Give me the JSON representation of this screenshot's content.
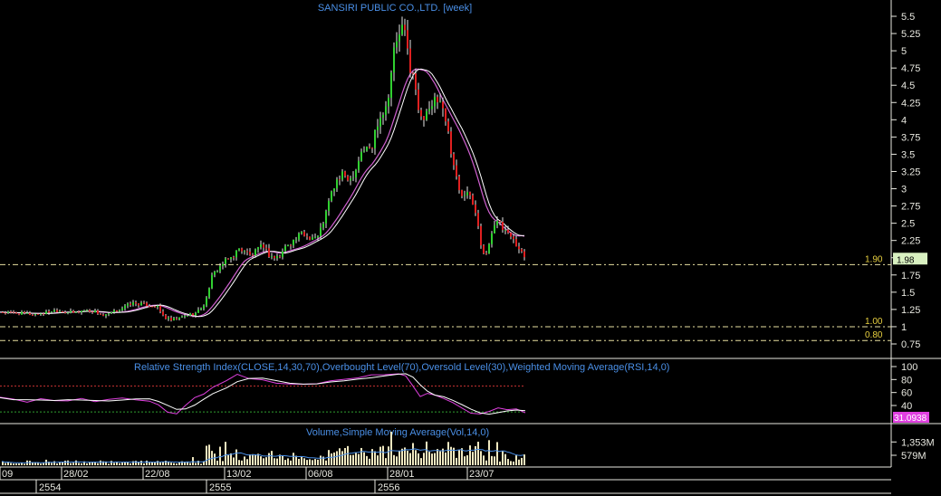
{
  "chart_data": {
    "type": "candlestick",
    "title": "SANSIRI PUBLIC CO.,LTD. [week]",
    "price_axis": {
      "ylim": [
        0.6,
        5.6
      ],
      "ticks": [
        "5.5",
        "5.25",
        "5",
        "4.75",
        "4.5",
        "4.25",
        "4",
        "3.75",
        "3.5",
        "3.25",
        "3",
        "2.75",
        "2.5",
        "2.25",
        "2",
        "1.75",
        "1.5",
        "1.25",
        "1",
        "0.75"
      ],
      "tick_values": [
        5.5,
        5.25,
        5,
        4.75,
        4.5,
        4.25,
        4,
        3.75,
        3.5,
        3.25,
        3,
        2.75,
        2.5,
        2.25,
        2,
        1.75,
        1.5,
        1.25,
        1,
        0.75
      ]
    },
    "levels": [
      {
        "label": "1.90",
        "value": 1.9
      },
      {
        "label": "1.00",
        "value": 1.0
      },
      {
        "label": "0.80",
        "value": 0.8
      }
    ],
    "last_price": {
      "label": "1.98",
      "value": 1.98
    },
    "close_path": [
      [
        0,
        1.21
      ],
      [
        12,
        1.2
      ],
      [
        24,
        1.19
      ],
      [
        36,
        1.18
      ],
      [
        48,
        1.2
      ],
      [
        60,
        1.24
      ],
      [
        70,
        1.22
      ],
      [
        80,
        1.2
      ],
      [
        92,
        1.24
      ],
      [
        104,
        1.22
      ],
      [
        114,
        1.15
      ],
      [
        124,
        1.21
      ],
      [
        134,
        1.27
      ],
      [
        144,
        1.34
      ],
      [
        154,
        1.33
      ],
      [
        164,
        1.31
      ],
      [
        172,
        1.3
      ],
      [
        180,
        1.14
      ],
      [
        188,
        1.09
      ],
      [
        196,
        1.12
      ],
      [
        206,
        1.17
      ],
      [
        216,
        1.2
      ],
      [
        226,
        1.35
      ],
      [
        232,
        1.7
      ],
      [
        240,
        1.85
      ],
      [
        248,
        1.95
      ],
      [
        256,
        2.02
      ],
      [
        262,
        2.12
      ],
      [
        268,
        2.12
      ],
      [
        276,
        2.02
      ],
      [
        284,
        2.12
      ],
      [
        290,
        2.18
      ],
      [
        296,
        2.04
      ],
      [
        302,
        2.0
      ],
      [
        308,
        2.02
      ],
      [
        316,
        2.2
      ],
      [
        324,
        2.25
      ],
      [
        332,
        2.35
      ],
      [
        340,
        2.3
      ],
      [
        350,
        2.3
      ],
      [
        358,
        2.6
      ],
      [
        364,
        2.9
      ],
      [
        370,
        3.1
      ],
      [
        378,
        3.2
      ],
      [
        386,
        3.15
      ],
      [
        392,
        3.3
      ],
      [
        398,
        3.55
      ],
      [
        404,
        3.58
      ],
      [
        410,
        3.6
      ],
      [
        414,
        3.9
      ],
      [
        420,
        4.1
      ],
      [
        426,
        4.2
      ],
      [
        430,
        4.6
      ],
      [
        434,
        5.0
      ],
      [
        440,
        5.25
      ],
      [
        444,
        5.35
      ],
      [
        448,
        5.1
      ],
      [
        452,
        4.75
      ],
      [
        456,
        4.6
      ],
      [
        460,
        4.2
      ],
      [
        464,
        4.0
      ],
      [
        468,
        4.1
      ],
      [
        472,
        4.2
      ],
      [
        476,
        4.15
      ],
      [
        480,
        4.3
      ],
      [
        486,
        4.2
      ],
      [
        490,
        4.0
      ],
      [
        494,
        3.8
      ],
      [
        498,
        3.5
      ],
      [
        502,
        3.2
      ],
      [
        506,
        3.0
      ],
      [
        510,
        2.9
      ],
      [
        514,
        3.0
      ],
      [
        518,
        2.85
      ],
      [
        522,
        2.75
      ],
      [
        526,
        2.55
      ],
      [
        530,
        2.2
      ],
      [
        534,
        2.0
      ],
      [
        540,
        2.25
      ],
      [
        546,
        2.5
      ],
      [
        550,
        2.6
      ],
      [
        554,
        2.45
      ],
      [
        560,
        2.4
      ],
      [
        566,
        2.3
      ],
      [
        570,
        2.15
      ],
      [
        576,
        2.05
      ],
      [
        580,
        1.98
      ]
    ],
    "rsi": {
      "label": "Relative Strength Index(CLOSE,14,30,70),Overbought Level(70),Oversold Level(30),Weighted Moving Average(RSI,14,0)",
      "ticks": [
        "100",
        "80",
        "60",
        "40"
      ],
      "tick_values": [
        100,
        80,
        60,
        40
      ],
      "ylim": [
        15,
        105
      ],
      "overbought": 70,
      "oversold": 30,
      "last_value_label": "31.0938",
      "points": [
        [
          0,
          52
        ],
        [
          15,
          49
        ],
        [
          30,
          46
        ],
        [
          45,
          50
        ],
        [
          60,
          47
        ],
        [
          75,
          50
        ],
        [
          90,
          48
        ],
        [
          105,
          45
        ],
        [
          120,
          48
        ],
        [
          135,
          52
        ],
        [
          150,
          50
        ],
        [
          165,
          49
        ],
        [
          175,
          40
        ],
        [
          185,
          32
        ],
        [
          195,
          30
        ],
        [
          205,
          42
        ],
        [
          215,
          50
        ],
        [
          225,
          57
        ],
        [
          235,
          68
        ],
        [
          250,
          76
        ],
        [
          262,
          86
        ],
        [
          275,
          83
        ],
        [
          290,
          78
        ],
        [
          305,
          74
        ],
        [
          320,
          71
        ],
        [
          335,
          74
        ],
        [
          350,
          75
        ],
        [
          365,
          80
        ],
        [
          380,
          79
        ],
        [
          395,
          83
        ],
        [
          410,
          86
        ],
        [
          425,
          88
        ],
        [
          440,
          91
        ],
        [
          448,
          88
        ],
        [
          456,
          72
        ],
        [
          464,
          56
        ],
        [
          472,
          58
        ],
        [
          480,
          54
        ],
        [
          490,
          48
        ],
        [
          500,
          42
        ],
        [
          510,
          34
        ],
        [
          520,
          27
        ],
        [
          530,
          25
        ],
        [
          540,
          28
        ],
        [
          550,
          34
        ],
        [
          560,
          33
        ],
        [
          570,
          32
        ],
        [
          580,
          31
        ]
      ]
    },
    "volume": {
      "label": "Volume,Simple Moving Average(Vol,14,0)",
      "ticks": [
        "1,353M",
        "579M"
      ],
      "tick_values": [
        1353,
        579
      ],
      "ylim": [
        0,
        2000
      ]
    },
    "x_ticks": [
      "09",
      "28/02",
      "22/08",
      "13/02",
      "06/08",
      "28/01",
      "23/07"
    ],
    "year_ticks": [
      "2554",
      "2555",
      "2556"
    ]
  }
}
